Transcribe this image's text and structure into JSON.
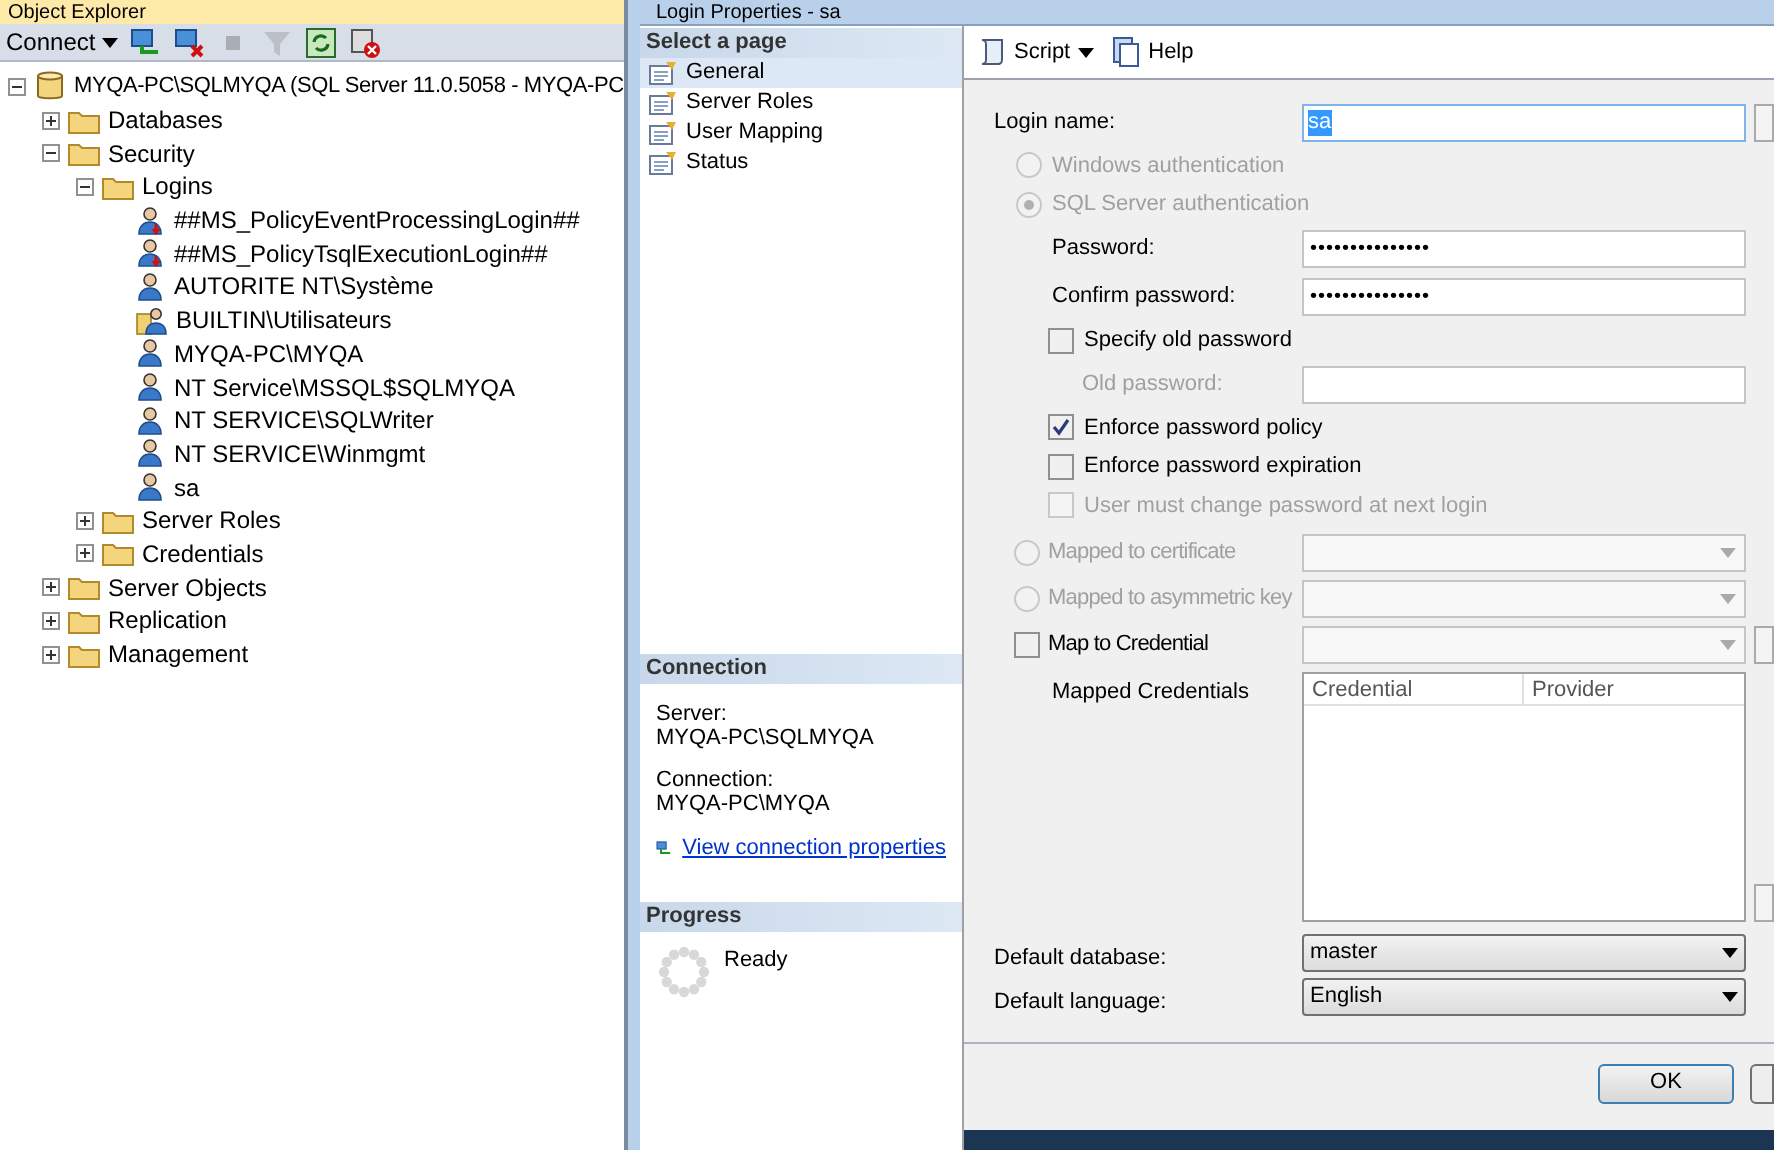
{
  "object_explorer": {
    "title": "Object Explorer",
    "toolbar": {
      "connect": "Connect",
      "icons": [
        {
          "kind": "connect",
          "disabled": false
        },
        {
          "kind": "disconnect",
          "disabled": false
        },
        {
          "kind": "stop",
          "disabled": true
        },
        {
          "kind": "filter",
          "disabled": true
        },
        {
          "kind": "refresh",
          "disabled": false
        },
        {
          "kind": "remove",
          "disabled": false
        }
      ]
    },
    "tree": [
      {
        "kind": "server",
        "label": "MYQA-PC\\SQLMYQA (SQL Server 11.0.5058 - MYQA-PC",
        "expanded": true,
        "children": [
          {
            "kind": "folder",
            "label": "Databases",
            "expanded": false
          },
          {
            "kind": "folder",
            "label": "Security",
            "expanded": true,
            "children": [
              {
                "kind": "folder",
                "label": "Logins",
                "expanded": true,
                "children": [
                  {
                    "kind": "login-disabled",
                    "label": "##MS_PolicyEventProcessingLogin##"
                  },
                  {
                    "kind": "login-disabled",
                    "label": "##MS_PolicyTsqlExecutionLogin##"
                  },
                  {
                    "kind": "login",
                    "label": "AUTORITE NT\\Système"
                  },
                  {
                    "kind": "group",
                    "label": "BUILTIN\\Utilisateurs"
                  },
                  {
                    "kind": "login",
                    "label": "MYQA-PC\\MYQA"
                  },
                  {
                    "kind": "login",
                    "label": "NT Service\\MSSQL$SQLMYQA"
                  },
                  {
                    "kind": "login",
                    "label": "NT SERVICE\\SQLWriter"
                  },
                  {
                    "kind": "login",
                    "label": "NT SERVICE\\Winmgmt"
                  },
                  {
                    "kind": "login",
                    "label": "sa"
                  }
                ]
              },
              {
                "kind": "folder",
                "label": "Server Roles",
                "expanded": false
              },
              {
                "kind": "folder",
                "label": "Credentials",
                "expanded": false
              }
            ]
          },
          {
            "kind": "folder",
            "label": "Server Objects",
            "expanded": false
          },
          {
            "kind": "folder",
            "label": "Replication",
            "expanded": false
          },
          {
            "kind": "folder",
            "label": "Management",
            "expanded": false
          }
        ]
      }
    ]
  },
  "dialog": {
    "title": "Login Properties - sa",
    "select_page": {
      "header": "Select a page",
      "items": [
        {
          "label": "General",
          "selected": true
        },
        {
          "label": "Server Roles",
          "selected": false
        },
        {
          "label": "User Mapping",
          "selected": false
        },
        {
          "label": "Status",
          "selected": false
        }
      ]
    },
    "connection": {
      "header": "Connection",
      "server_label": "Server:",
      "server": "MYQA-PC\\SQLMYQA",
      "connection_label": "Connection:",
      "connection": "MYQA-PC\\MYQA",
      "link": "View connection properties"
    },
    "progress": {
      "header": "Progress",
      "status": "Ready"
    },
    "toolbar": {
      "script": "Script",
      "help": "Help"
    },
    "general": {
      "login_name": {
        "label": "Login name:",
        "value": "sa"
      },
      "auth_options": [
        {
          "label": "Windows authentication",
          "selected": false,
          "disabled": true
        },
        {
          "label": "SQL Server authentication",
          "selected": true,
          "disabled": true
        }
      ],
      "password": {
        "label": "Password:",
        "value": "•••••••••••••••"
      },
      "confirm_password": {
        "label": "Confirm password:",
        "value": "•••••••••••••••"
      },
      "specify_old": {
        "label": "Specify old password",
        "checked": false,
        "disabled": false
      },
      "old_password": {
        "label": "Old password:",
        "disabled": true
      },
      "policies": [
        {
          "label": "Enforce password policy",
          "checked": true,
          "disabled": false
        },
        {
          "label": "Enforce password expiration",
          "checked": false,
          "disabled": false
        },
        {
          "label": "User must change password at next login",
          "checked": false,
          "disabled": true
        }
      ],
      "mappings": [
        {
          "kind": "radio",
          "label": "Mapped to certificate",
          "checked": false,
          "disabled": true
        },
        {
          "kind": "radio",
          "label": "Mapped to asymmetric key",
          "checked": false,
          "disabled": true
        },
        {
          "kind": "checkbox",
          "label": "Map to Credential",
          "checked": false,
          "disabled": false
        }
      ],
      "mapped_credentials": {
        "label": "Mapped Credentials",
        "columns": [
          "Credential",
          "Provider"
        ]
      },
      "defaults": [
        {
          "label": "Default database:",
          "value": "master"
        },
        {
          "label": "Default language:",
          "value": "English"
        }
      ]
    },
    "buttons": [
      "OK"
    ]
  }
}
